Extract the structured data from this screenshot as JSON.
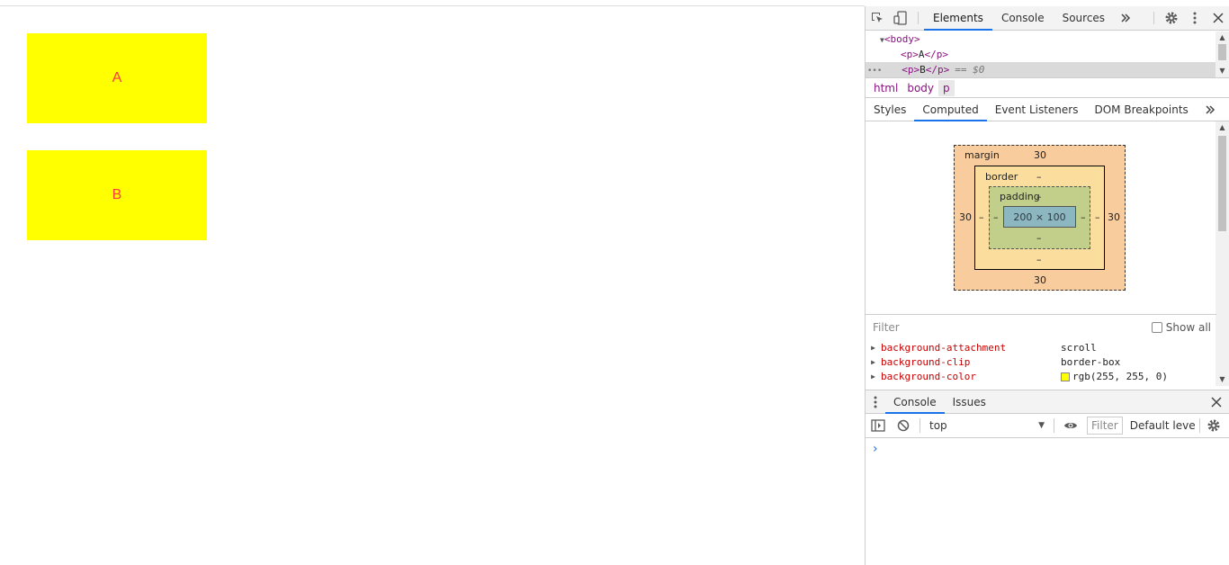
{
  "page": {
    "boxes": [
      {
        "text": "A"
      },
      {
        "text": "B"
      }
    ],
    "box_color": "#ffff00",
    "text_color": "#ff3b3b"
  },
  "devtools": {
    "tabs": [
      "Elements",
      "Console",
      "Sources"
    ],
    "active_tab": "Elements",
    "more_icon": "chevrons-right-icon",
    "dom": {
      "body_tag": "<body>",
      "p_open": "<p>",
      "p_close": "</p>",
      "line1_text": "A",
      "line2_text": "B",
      "selected_marker": "== $0",
      "dots": "•••"
    },
    "breadcrumbs": [
      "html",
      "body",
      "p"
    ],
    "subtabs": [
      "Styles",
      "Computed",
      "Event Listeners",
      "DOM Breakpoints"
    ],
    "active_subtab": "Computed",
    "box_model": {
      "margin_label": "margin",
      "margin_top": "30",
      "margin_bottom": "30",
      "margin_left": "30",
      "margin_right": "30",
      "border_label": "border",
      "border_top": "–",
      "border_bottom": "–",
      "border_left": "–",
      "border_right": "–",
      "padding_label": "padding",
      "padding_top": "–",
      "padding_bottom": "–",
      "padding_left": "–",
      "padding_right": "–",
      "content": "200 × 100"
    },
    "filter_placeholder": "Filter",
    "show_all_label": "Show all",
    "properties": [
      {
        "name": "background-attachment",
        "value": "scroll"
      },
      {
        "name": "background-clip",
        "value": "border-box"
      },
      {
        "name": "background-color",
        "value": "rgb(255, 255, 0)",
        "swatch": "#ffff00"
      }
    ],
    "drawer": {
      "tabs": [
        "Console",
        "Issues"
      ],
      "active_tab": "Console",
      "context": "top",
      "filter_placeholder": "Filter",
      "levels": "Default leve",
      "prompt": "›"
    }
  }
}
